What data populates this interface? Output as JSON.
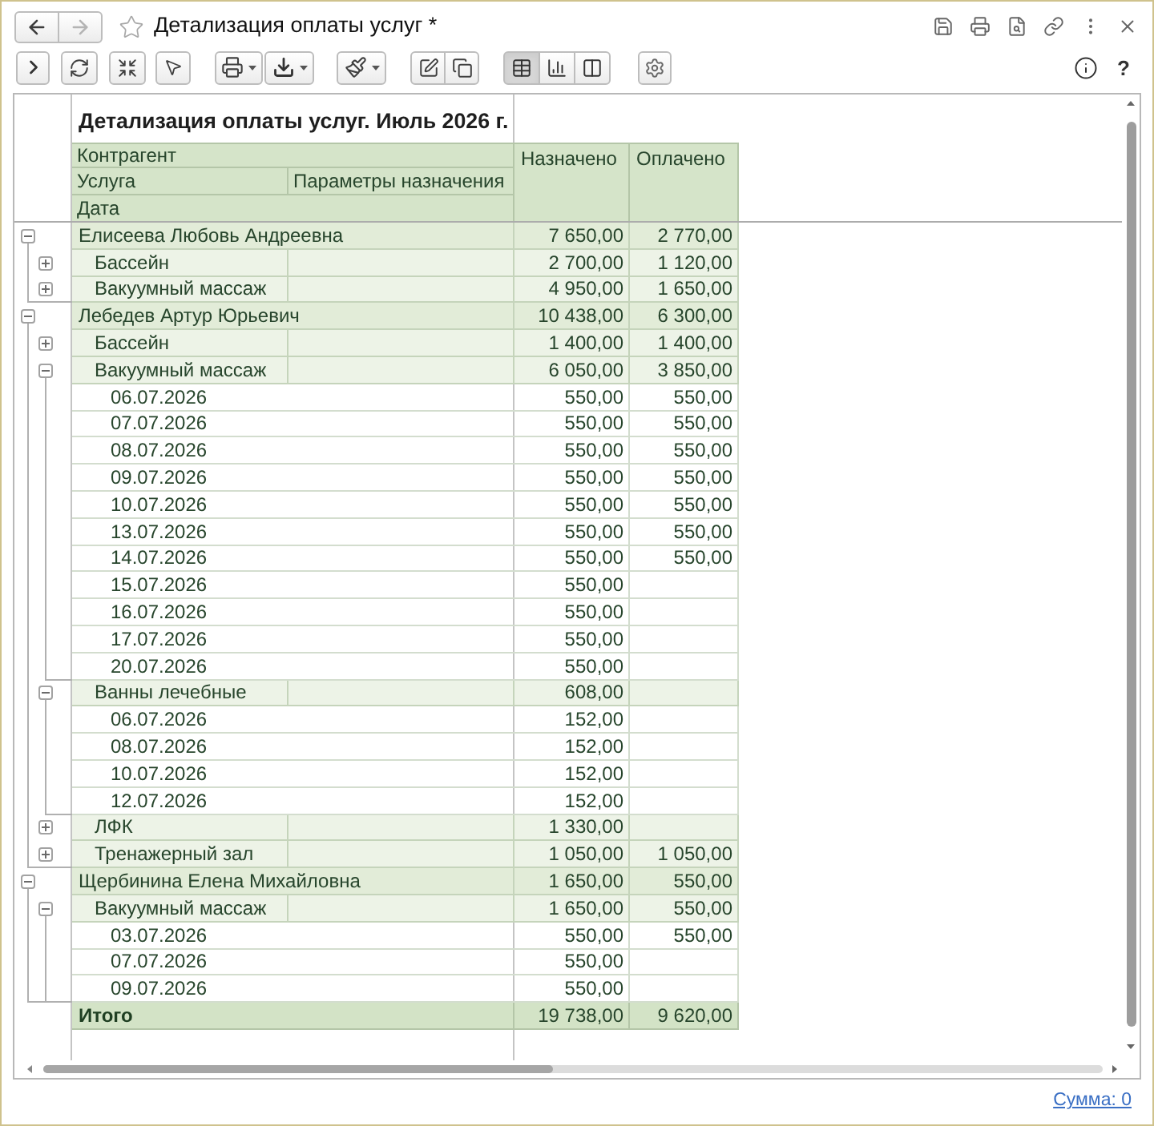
{
  "window": {
    "title": "Детализация оплаты услуг *"
  },
  "navigation": [
    {
      "kind": "back",
      "disabled": false
    },
    {
      "kind": "forward",
      "disabled": true
    }
  ],
  "toolbar": {
    "view_modes": [
      {
        "kind": "table",
        "selected": true
      },
      {
        "kind": "chart",
        "selected": false
      },
      {
        "kind": "split",
        "selected": false
      }
    ],
    "help_label": "?"
  },
  "report": {
    "title": "Детализация оплаты услуг. Июль 2026 г.",
    "columns": {
      "counterparty": "Контрагент",
      "service": "Услуга",
      "parameters": "Параметры назначения",
      "date": "Дата",
      "assigned": "Назначено",
      "paid": "Оплачено"
    },
    "rows": [
      {
        "label": "Елисеева Любовь Андреевна",
        "assigned": "7 650,00",
        "paid": "2 770,00",
        "expanded": true,
        "children": [
          {
            "label": "Бассейн",
            "assigned": "2 700,00",
            "paid": "1 120,00",
            "expanded": false
          },
          {
            "label": "Вакуумный массаж",
            "assigned": "4 950,00",
            "paid": "1 650,00",
            "expanded": false
          }
        ]
      },
      {
        "label": "Лебедев Артур Юрьевич",
        "assigned": "10 438,00",
        "paid": "6 300,00",
        "expanded": true,
        "children": [
          {
            "label": "Бассейн",
            "assigned": "1 400,00",
            "paid": "1 400,00",
            "expanded": false
          },
          {
            "label": "Вакуумный массаж",
            "assigned": "6 050,00",
            "paid": "3 850,00",
            "expanded": true,
            "children": [
              {
                "label": "06.07.2026",
                "assigned": "550,00",
                "paid": "550,00"
              },
              {
                "label": "07.07.2026",
                "assigned": "550,00",
                "paid": "550,00"
              },
              {
                "label": "08.07.2026",
                "assigned": "550,00",
                "paid": "550,00"
              },
              {
                "label": "09.07.2026",
                "assigned": "550,00",
                "paid": "550,00"
              },
              {
                "label": "10.07.2026",
                "assigned": "550,00",
                "paid": "550,00"
              },
              {
                "label": "13.07.2026",
                "assigned": "550,00",
                "paid": "550,00"
              },
              {
                "label": "14.07.2026",
                "assigned": "550,00",
                "paid": "550,00"
              },
              {
                "label": "15.07.2026",
                "assigned": "550,00"
              },
              {
                "label": "16.07.2026",
                "assigned": "550,00"
              },
              {
                "label": "17.07.2026",
                "assigned": "550,00"
              },
              {
                "label": "20.07.2026",
                "assigned": "550,00"
              }
            ]
          },
          {
            "label": "Ванны лечебные",
            "assigned": "608,00",
            "expanded": true,
            "children": [
              {
                "label": "06.07.2026",
                "assigned": "152,00"
              },
              {
                "label": "08.07.2026",
                "assigned": "152,00"
              },
              {
                "label": "10.07.2026",
                "assigned": "152,00"
              },
              {
                "label": "12.07.2026",
                "assigned": "152,00"
              }
            ]
          },
          {
            "label": "ЛФК",
            "assigned": "1 330,00",
            "expanded": false
          },
          {
            "label": "Тренажерный зал",
            "assigned": "1 050,00",
            "paid": "1 050,00",
            "expanded": false
          }
        ]
      },
      {
        "label": "Щербинина Елена Михайловна",
        "assigned": "1 650,00",
        "paid": "550,00",
        "expanded": true,
        "children": [
          {
            "label": "Вакуумный массаж",
            "assigned": "1 650,00",
            "paid": "550,00",
            "expanded": true,
            "children": [
              {
                "label": "03.07.2026",
                "assigned": "550,00",
                "paid": "550,00"
              },
              {
                "label": "07.07.2026",
                "assigned": "550,00"
              },
              {
                "label": "09.07.2026",
                "assigned": "550,00"
              }
            ]
          }
        ]
      }
    ],
    "total": {
      "label": "Итого",
      "assigned": "19 738,00",
      "paid": "9 620,00"
    }
  },
  "footer": {
    "sum_link": "Сумма: 0"
  }
}
